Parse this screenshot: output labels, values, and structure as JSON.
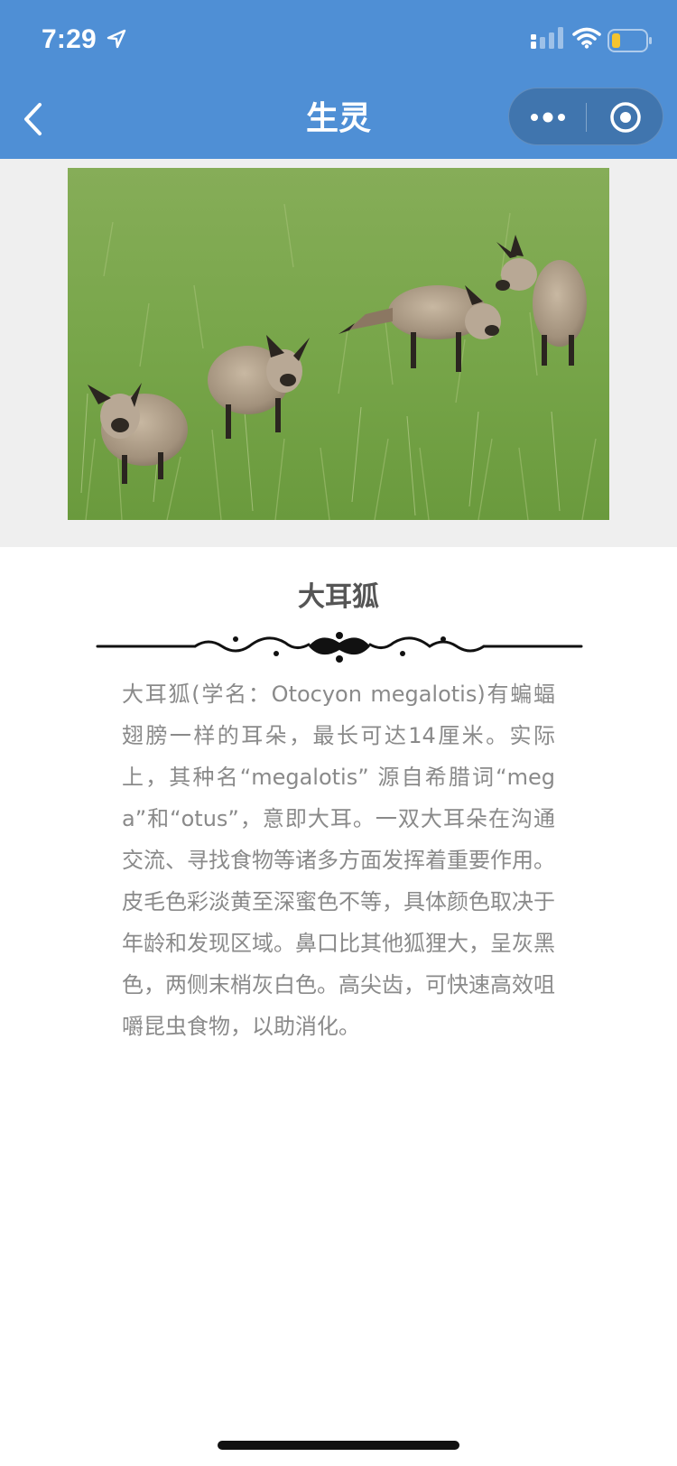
{
  "status_bar": {
    "time": "7:29",
    "location_icon": "location-arrow-icon",
    "signal_icon": "cellular-signal-icon",
    "wifi_icon": "wifi-icon",
    "battery_icon": "battery-low-icon",
    "battery_level": 0.25
  },
  "nav": {
    "title": "生灵",
    "back_icon": "chevron-left-icon",
    "more_icon": "more-dots-icon",
    "close_icon": "target-circle-icon"
  },
  "article": {
    "photo_subject": "bat-eared foxes in grass",
    "title": "大耳狐",
    "divider_icon": "ornamental-flourish-icon",
    "body": "大耳狐(学名：Otocyon megalotis)有蝙蝠翅膀一样的耳朵，最长可达14厘米。实际上，其种名“megalotis” 源自希腊词“mega”和“otus”，意即大耳。一双大耳朵在沟通交流、寻找食物等诸多方面发挥着重要作用。皮毛色彩淡黄至深蜜色不等，具体颜色取决于年龄和发现区域。鼻口比其他狐狸大，呈灰黑色，两侧末梢灰白色。高尖齿，可快速高效咀嚼昆虫食物，以助消化。"
  },
  "colors": {
    "header_blue": "#4f8fd5",
    "battery_yellow": "#f4c430",
    "body_text": "#8a8a8a",
    "title_text": "#555555"
  }
}
